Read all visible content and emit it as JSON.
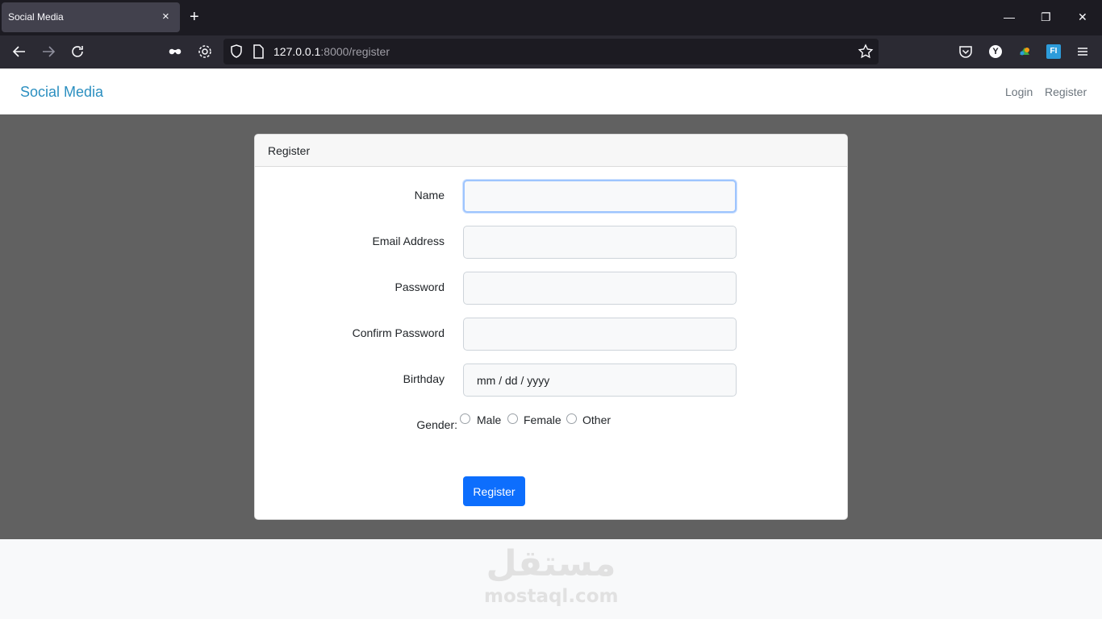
{
  "browser": {
    "tab_title": "Social Media",
    "tab_close": "×",
    "new_tab": "+",
    "url_host": "127.0.0.1",
    "url_rest": ":8000/register",
    "window": {
      "minimize": "—",
      "restore": "❐",
      "close": "✕"
    },
    "extension_y": "Y",
    "extension_fi": "FI"
  },
  "navbar": {
    "brand": "Social Media",
    "links": [
      "Login",
      "Register"
    ]
  },
  "card": {
    "header": "Register",
    "fields": [
      {
        "label": "Name",
        "value": ""
      },
      {
        "label": "Email Address",
        "value": ""
      },
      {
        "label": "Password",
        "value": ""
      },
      {
        "label": "Confirm Password",
        "value": ""
      },
      {
        "label": "Birthday",
        "value": "mm / dd / yyyy"
      }
    ],
    "gender": {
      "label": "Gender:",
      "options": [
        "Male",
        "Female",
        "Other"
      ]
    },
    "submit": "Register"
  },
  "watermark": {
    "arabic": "مستقل",
    "latin": "mostaql.com"
  },
  "colors": {
    "brand": "#2b8fc0",
    "primary_button": "#0d6efd",
    "page_background": "#616161",
    "chrome_dark": "#1c1b22"
  }
}
